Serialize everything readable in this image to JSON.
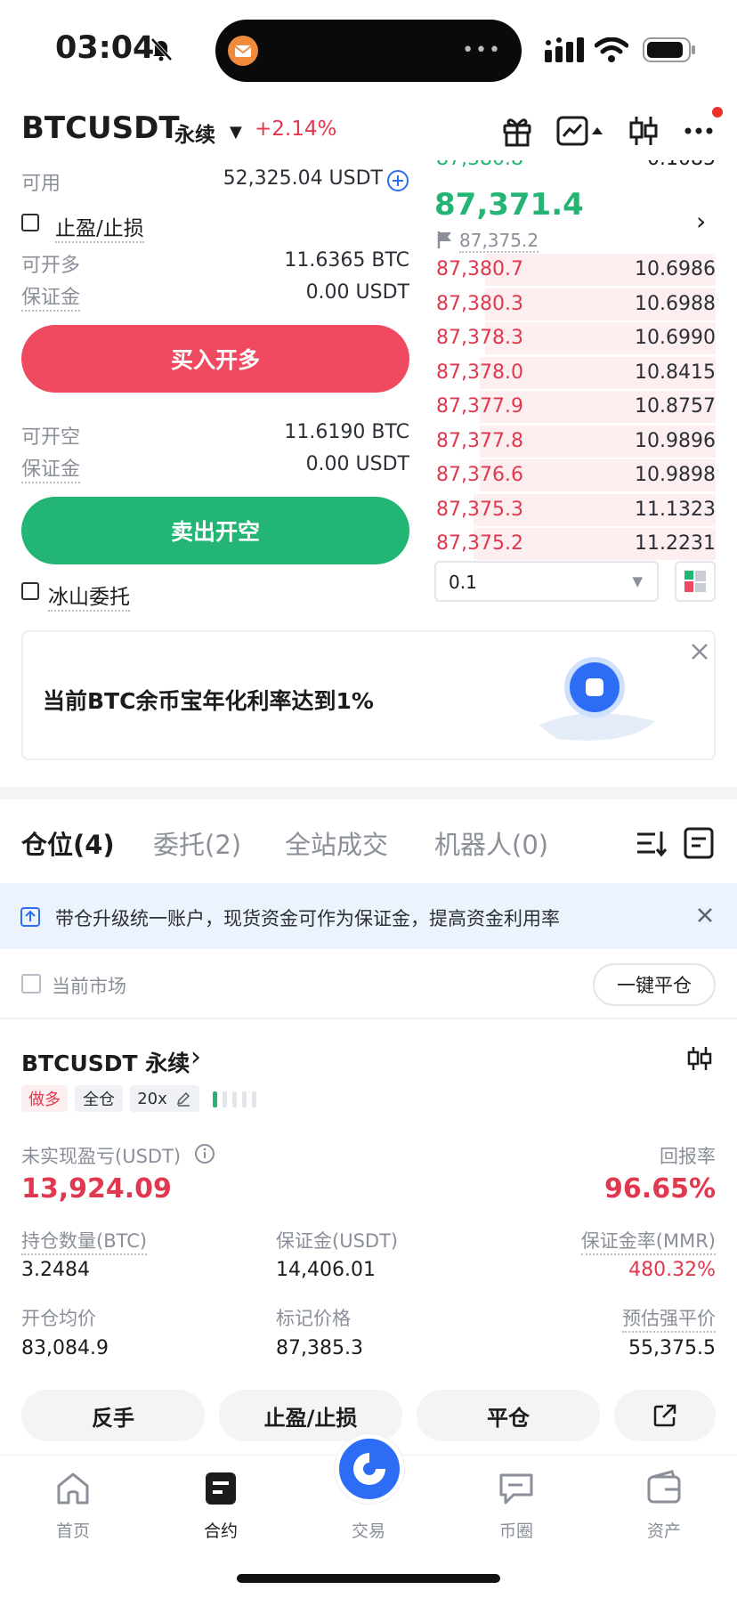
{
  "status_bar": {
    "time": "03:04",
    "island_dots": "•••"
  },
  "header": {
    "symbol": "BTCUSDT",
    "contract_type": "永续",
    "change": "+2.14%"
  },
  "form": {
    "available_label": "可用",
    "available_value": "52,325.04 USDT",
    "tp_sl_label": "止盈/止损",
    "long_max_label": "可开多",
    "long_max_value": "11.6365 BTC",
    "long_margin_label": "保证金",
    "long_margin_value": "0.00 USDT",
    "buy_button": "买入开多",
    "short_max_label": "可开空",
    "short_max_value": "11.6190 BTC",
    "short_margin_label": "保证金",
    "short_margin_value": "0.00 USDT",
    "sell_button": "卖出开空",
    "iceberg_label": "冰山委托"
  },
  "orderbook": {
    "clipped_price": "87,380.8",
    "clipped_qty": "0.1085",
    "last_price": "87,371.4",
    "mark_price": "87,375.2",
    "rows": [
      {
        "price": "87,380.7",
        "qty": "10.6986",
        "depth": 0.34
      },
      {
        "price": "87,380.3",
        "qty": "10.6988",
        "depth": 0.34
      },
      {
        "price": "87,378.3",
        "qty": "10.6990",
        "depth": 0.34
      },
      {
        "price": "87,378.0",
        "qty": "10.8415",
        "depth": 0.35
      },
      {
        "price": "87,377.9",
        "qty": "10.8757",
        "depth": 0.35
      },
      {
        "price": "87,377.8",
        "qty": "10.9896",
        "depth": 0.35
      },
      {
        "price": "87,376.6",
        "qty": "10.9898",
        "depth": 0.35
      },
      {
        "price": "87,375.3",
        "qty": "11.1323",
        "depth": 0.36
      },
      {
        "price": "87,375.2",
        "qty": "11.2231",
        "depth": 0.36
      }
    ],
    "precision_value": "0.1"
  },
  "promo": {
    "text": "当前BTC余币宝年化利率达到1%"
  },
  "tabs": [
    {
      "label": "仓位(4)"
    },
    {
      "label": "委托(2)"
    },
    {
      "label": "全站成交"
    },
    {
      "label": "机器人(0)"
    }
  ],
  "notice": {
    "text": "带仓升级统一账户，现货资金可作为保证金，提高资金利用率"
  },
  "filter": {
    "current_market_label": "当前市场",
    "close_all_button": "一键平仓"
  },
  "position": {
    "symbol": "BTCUSDT 永续",
    "side_tag": "做多",
    "margin_mode_tag": "全仓",
    "leverage_tag": "20x",
    "pnl_label": "未实现盈亏(USDT)",
    "pnl_value": "13,924.09",
    "roe_label": "回报率",
    "roe_value": "96.65%",
    "size_label": "持仓数量(BTC)",
    "size_value": "3.2484",
    "margin_label": "保证金(USDT)",
    "margin_value": "14,406.01",
    "mmr_label": "保证金率(MMR)",
    "mmr_value": "480.32%",
    "entry_label": "开仓均价",
    "entry_value": "83,084.9",
    "mark_label": "标记价格",
    "mark_value": "87,385.3",
    "liq_label": "预估强平价",
    "liq_value": "55,375.5",
    "actions": {
      "reverse": "反手",
      "tp_sl": "止盈/止损",
      "close": "平仓"
    }
  },
  "nav": [
    {
      "label": "首页"
    },
    {
      "label": "合约"
    },
    {
      "label": "交易"
    },
    {
      "label": "币圈"
    },
    {
      "label": "资产"
    }
  ],
  "colors": {
    "red": "#e0384e",
    "green": "#24b574",
    "accent_blue": "#2d6df6"
  }
}
